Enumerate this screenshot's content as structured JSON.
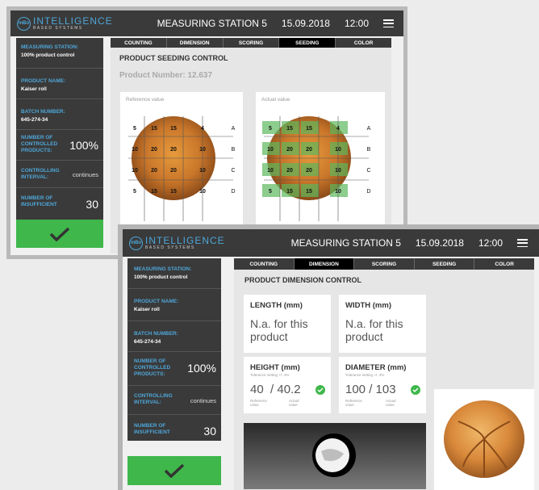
{
  "logo": {
    "mark": "mBo",
    "name": "INTELLIGENCE",
    "tagline": "BASED SYSTEMS"
  },
  "win1": {
    "station": "MEASURING STATION 5",
    "date": "15.09.2018",
    "time": "12:00",
    "sidebar": {
      "station_label": "MEASURING STATION:",
      "station_value": "100% product control",
      "product_label": "PRODUCT NAME:",
      "product_value": "Kaiser roll",
      "batch_label": "BATCH NUMBER:",
      "batch_value": "645-274-34",
      "controlled_label": "NUMBER OF CONTROLLED PRODUCTS:",
      "controlled_value": "100%",
      "interval_label": "CONTROLLING INTERVAL:",
      "interval_value": "continues",
      "insufficient_label": "NUMBER OF INSUFFICIENT",
      "insufficient_value": "30"
    },
    "tabs": [
      "COUNTING",
      "DIMENSION",
      "SCORING",
      "SEEDING",
      "COLOR"
    ],
    "active_tab": "SEEDING",
    "heading": "PRODUCT SEEDING CONTROL",
    "product_number": "Product Number: 12.637",
    "reference_title": "Reference value",
    "actual_title": "Actual value",
    "grid_rows": [
      [
        "5",
        "15",
        "15",
        "4"
      ],
      [
        "10",
        "20",
        "20",
        "10"
      ],
      [
        "10",
        "20",
        "20",
        "10"
      ],
      [
        "5",
        "15",
        "15",
        "10"
      ]
    ],
    "row_labels": [
      "A",
      "B",
      "C",
      "D"
    ]
  },
  "win2": {
    "station": "MEASURING STATION 5",
    "date": "15.09.2018",
    "time": "12:00",
    "sidebar": {
      "station_label": "MEASURING STATION:",
      "station_value": "100% product control",
      "product_label": "PRODUCT NAME:",
      "product_value": "Kaiser roll",
      "batch_label": "BATCH NUMBER:",
      "batch_value": "645-274-34",
      "controlled_label": "NUMBER OF CONTROLLED PRODUCTS:",
      "controlled_value": "100%",
      "interval_label": "CONTROLLING INTERVAL:",
      "interval_value": "continues",
      "insufficient_label": "NUMBER OF INSUFFICIENT",
      "insufficient_value": "30"
    },
    "tabs": [
      "COUNTING",
      "DIMENSION",
      "SCORING",
      "SEEDING",
      "COLOR"
    ],
    "active_tab": "DIMENSION",
    "heading": "PRODUCT DIMENSION CONTROL",
    "length": {
      "title": "LENGTH (mm)",
      "text": "N.a. for this product"
    },
    "width": {
      "title": "WIDTH (mm)",
      "text": "N.a. for this product"
    },
    "height": {
      "title": "HEIGHT (mm)",
      "tolerance": "Tolerance setting +/- 3%",
      "reference": "40",
      "actual": "40.2",
      "ref_label": "Reference value",
      "act_label": "Actual value"
    },
    "diameter": {
      "title": "DIAMETER (mm)",
      "tolerance": "Tolerance setting +/- 3%",
      "reference": "100",
      "actual": "103",
      "ref_label": "Reference value",
      "act_label": "Actual value"
    }
  }
}
